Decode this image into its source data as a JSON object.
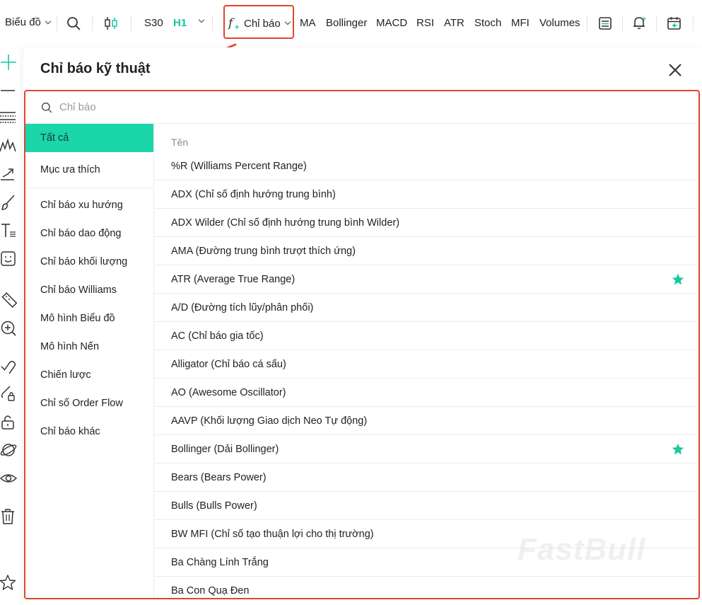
{
  "toolbar": {
    "chart_type": "Biểu đồ",
    "symbol": "S30",
    "timeframe": "H1",
    "indicators_label": "Chỉ báo",
    "quick_indicators": [
      "MA",
      "Bollinger",
      "MACD",
      "RSI",
      "ATR",
      "Stoch",
      "MFI",
      "Volumes"
    ]
  },
  "dialog": {
    "title": "Chỉ báo kỹ thuật",
    "search_placeholder": "Chỉ báo",
    "categories": [
      "Tất cả",
      "Mục ưa thích",
      "Chỉ báo xu hướng",
      "Chỉ báo dao động",
      "Chỉ báo khối lượng",
      "Chỉ báo Williams",
      "Mô hình Biểu đồ",
      "Mô hình Nến",
      "Chiến lược",
      "Chỉ số Order Flow",
      "Chỉ báo khác"
    ],
    "active_category": "Tất cả",
    "list_header": "Tên",
    "items": [
      {
        "name": "%R (Williams Percent Range)",
        "favorite": false
      },
      {
        "name": "ADX (Chỉ số định hướng trung bình)",
        "favorite": false
      },
      {
        "name": "ADX Wilder (Chỉ số định hướng trung bình Wilder)",
        "favorite": false
      },
      {
        "name": "AMA (Đường trung bình trượt thích ứng)",
        "favorite": false
      },
      {
        "name": "ATR (Average True Range)",
        "favorite": true
      },
      {
        "name": "A/D (Đường tích lũy/phân phối)",
        "favorite": false
      },
      {
        "name": "AC (Chỉ báo gia tốc)",
        "favorite": false
      },
      {
        "name": "Alligator (Chỉ báo cá sấu)",
        "favorite": false
      },
      {
        "name": "AO (Awesome Oscillator)",
        "favorite": false
      },
      {
        "name": "AAVP (Khối lượng Giao dịch Neo Tự động)",
        "favorite": false
      },
      {
        "name": "Bollinger (Dải Bollinger)",
        "favorite": true
      },
      {
        "name": "Bears (Bears Power)",
        "favorite": false
      },
      {
        "name": "Bulls (Bulls Power)",
        "favorite": false
      },
      {
        "name": "BW MFI (Chỉ số tạo thuận lợi cho thị trường)",
        "favorite": false
      },
      {
        "name": "Ba Chàng Lính Trắng",
        "favorite": false
      },
      {
        "name": "Ba Con Quạ Đen",
        "favorite": false
      }
    ]
  },
  "watermark": "FastBull",
  "colors": {
    "accent": "#1ad6a8",
    "highlight": "#e0452f",
    "star": "#1ac9a0"
  },
  "icons": {
    "toolbar": [
      "search-icon",
      "candlestick-icon",
      "function-icon",
      "layout-icon",
      "alert-bell-icon",
      "calendar-icon"
    ],
    "rail": [
      "crosshair-icon",
      "horizontal-line-icon",
      "fib-lines-icon",
      "wave-icon",
      "trend-arrow-icon",
      "brush-icon",
      "text-icon",
      "emoji-icon",
      "ruler-icon",
      "zoom-in-icon",
      "magnet-icon",
      "lock-drawing-icon",
      "unlock-icon",
      "planet-icon",
      "eye-icon",
      "trash-icon",
      "star-icon"
    ]
  }
}
